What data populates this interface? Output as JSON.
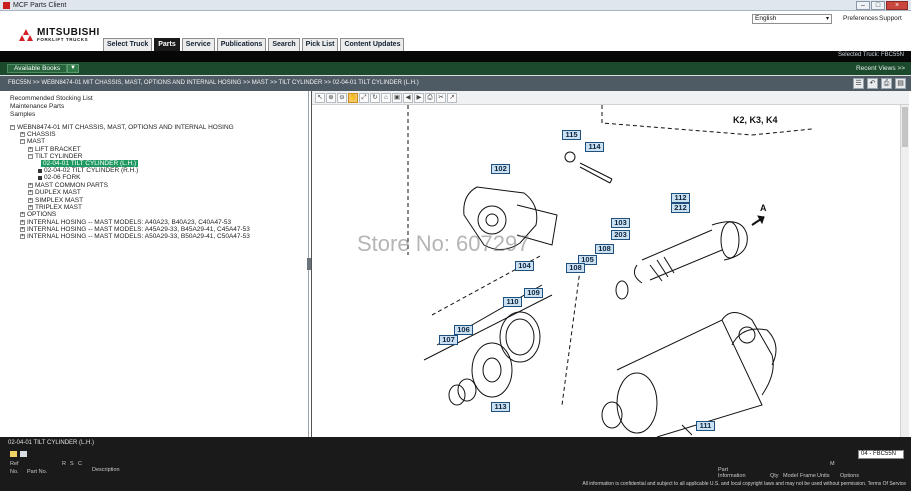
{
  "window": {
    "title": "MCF Parts Client",
    "controls": [
      "‒",
      "□",
      "×"
    ]
  },
  "header": {
    "logo_main": "MITSUBISHI",
    "logo_sub": "FORKLIFT TRUCKS",
    "language": "English",
    "links": {
      "preferences": "Preferences",
      "support": "Support"
    },
    "tabs": [
      "Select Truck",
      "Parts",
      "Service",
      "Publications",
      "Search",
      "Pick List",
      "Content Updates"
    ],
    "active_tab": "Parts",
    "selected_truck": "Selected Truck:  FBC55N"
  },
  "toolbar": {
    "available_books": "Available Books",
    "recent_views": "Recent Views >>"
  },
  "breadcrumb": "FBC55N >> WEBN8474-01 MIT CHASSIS, MAST, OPTIONS AND INTERNAL HOSING >> MAST >> TILT CYLINDER >> 02-04-01 TILT CYLINDER (L.H.)",
  "tree": {
    "top_links": [
      "Recommended Stocking List",
      "Maintenance Parts",
      "Samples"
    ],
    "nodes": [
      {
        "label": "WEBN8474-01 MIT CHASSIS, MAST, OPTIONS AND INTERNAL HOSING",
        "toggle": "−"
      },
      {
        "label": "CHASSIS",
        "toggle": "+"
      },
      {
        "label": "MAST",
        "toggle": "−"
      },
      {
        "label": "LIFT BRACKET",
        "toggle": "+"
      },
      {
        "label": "TILT CYLINDER",
        "toggle": "−"
      },
      {
        "label": "02-04-01 TILT CYLINDER (L.H.)",
        "toggle": ""
      },
      {
        "label": "02-04-02 TILT CYLINDER (R.H.)",
        "toggle": ""
      },
      {
        "label": "02-06 FORK",
        "toggle": ""
      },
      {
        "label": "MAST COMMON PARTS",
        "toggle": "+"
      },
      {
        "label": "DUPLEX MAST",
        "toggle": "+"
      },
      {
        "label": "SIMPLEX MAST",
        "toggle": "+"
      },
      {
        "label": "TRIPLEX MAST",
        "toggle": "+"
      },
      {
        "label": "OPTIONS",
        "toggle": "+"
      },
      {
        "label": "INTERNAL HOSING -- MAST MODELS: A40A23, B40A23, C40A47-53",
        "toggle": "+"
      },
      {
        "label": "INTERNAL HOSING -- MAST MODELS: A45A29-33, B45A29-41, C45A47-53",
        "toggle": "+"
      },
      {
        "label": "INTERNAL HOSING -- MAST MODELS: A50A29-33, B50A29-41, C50A47-53",
        "toggle": "+"
      }
    ]
  },
  "diagram": {
    "tools": [
      "↖",
      "⊕",
      "⊖",
      "✋",
      "⤢",
      "↻",
      "⌂",
      "▣",
      "◀",
      "▶",
      "⎙",
      "✂",
      "↗"
    ],
    "view_label": "K2, K3, K4",
    "arrow_label": "A",
    "watermark": "Store No: 607297",
    "callouts": [
      "115",
      "114",
      "102",
      "112",
      "212",
      "103",
      "203",
      "108",
      "105",
      "108",
      "104",
      "109",
      "110",
      "106",
      "107",
      "113",
      "111"
    ]
  },
  "bottom": {
    "panel_title": "02-04-01 TILT CYLINDER (L.H.)",
    "model_select": "04 - FBC55N",
    "columns_left": [
      "Ref",
      "No.",
      "Part No.",
      "R",
      "S",
      "C",
      "Description"
    ],
    "columns_right": [
      "Part",
      "Information",
      "Qty",
      "Model",
      "Frame",
      "Units",
      "M",
      "Options"
    ],
    "footer": "All information is confidential and subject to all applicable U.S. and local copyright laws and may not be used without permission.  Terms Of Service"
  }
}
